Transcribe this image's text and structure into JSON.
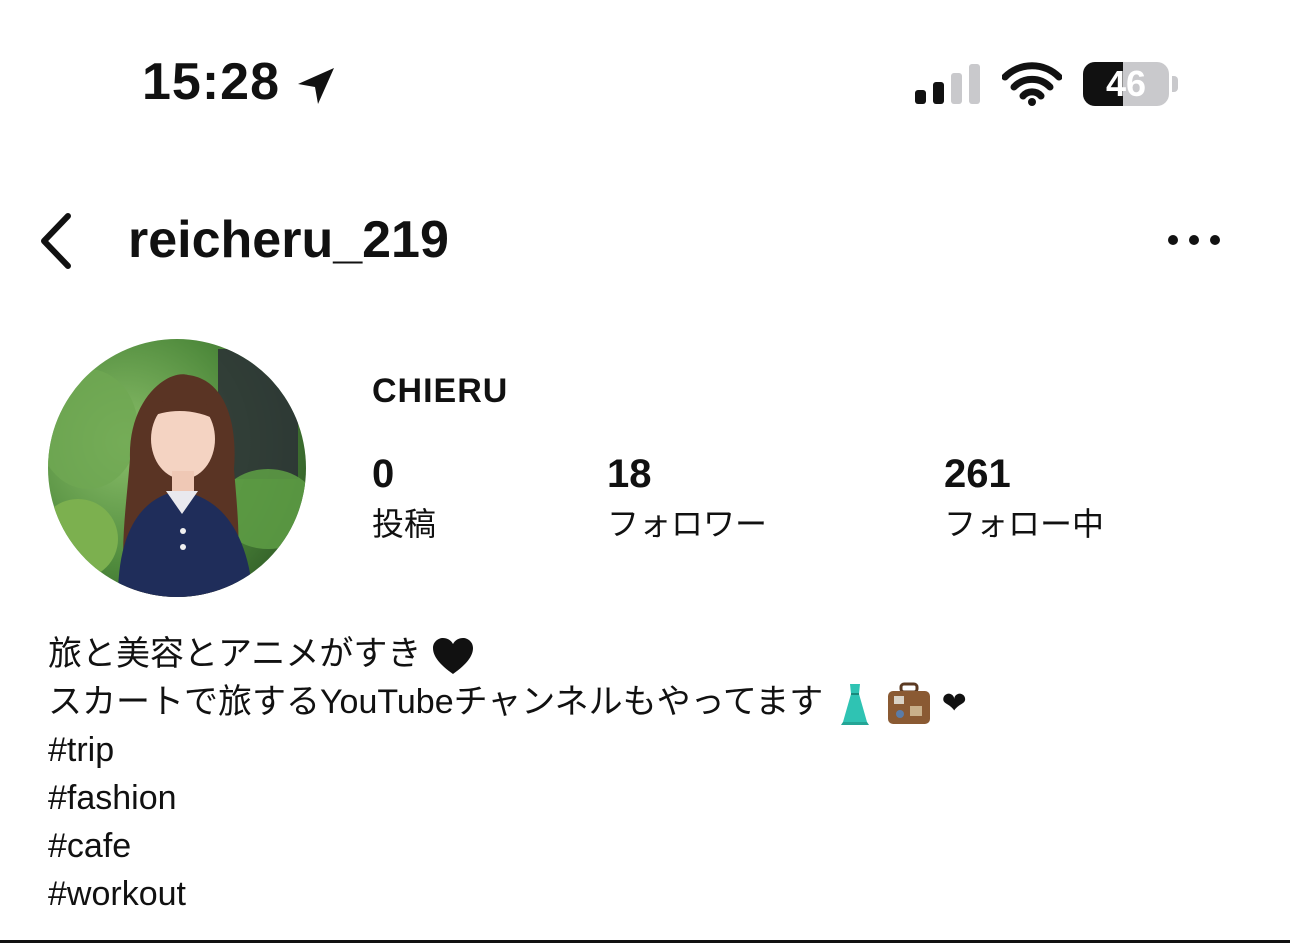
{
  "status_bar": {
    "time": "15:28",
    "battery_level": "46",
    "icons": [
      "location-arrow-icon",
      "cellular-signal-icon",
      "wifi-icon",
      "battery-icon"
    ]
  },
  "nav": {
    "username": "reicheru_219",
    "icons": [
      "chevron-left-icon",
      "more-horizontal-icon"
    ]
  },
  "profile": {
    "display_name": "CHIERU",
    "stats": [
      {
        "number": "0",
        "label": "投稿"
      },
      {
        "number": "18",
        "label": "フォロワー"
      },
      {
        "number": "261",
        "label": "フォロー中"
      }
    ]
  },
  "bio": {
    "line1": "旅と美容とアニメがすき",
    "line2": "スカートで旅するYouTubeチャンネルもやってます",
    "line2_trailing_heart": "❤",
    "hashtags": [
      "#trip",
      "#fashion",
      "#cafe",
      "#workout"
    ],
    "emoji_icons": [
      "black-heart-icon",
      "dress-icon",
      "suitcase-icon",
      "red-heart-icon"
    ]
  },
  "colors": {
    "text": "#111111",
    "battery_track": "#c9c9cc",
    "background": "#ffffff"
  }
}
